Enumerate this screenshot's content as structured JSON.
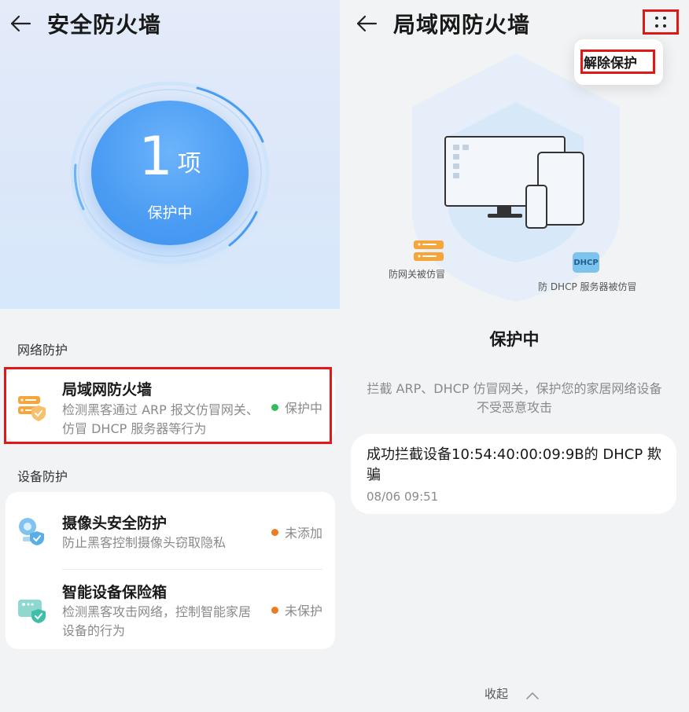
{
  "left": {
    "header": {
      "title": "安全防火墙",
      "back_icon": "back-arrow-icon"
    },
    "summary": {
      "count": "1",
      "unit": "项",
      "status": "保护中"
    },
    "network_section": {
      "label": "网络防护",
      "items": [
        {
          "title": "局域网防火墙",
          "desc": "检测黑客通过 ARP 报文仿冒网关、仿冒 DHCP 服务器等行为",
          "status": "保护中",
          "status_color": "#2fbe5a",
          "icon": "server-shield-icon"
        }
      ]
    },
    "device_section": {
      "label": "设备防护",
      "items": [
        {
          "title": "摄像头安全防护",
          "desc": "防止黑客控制摄像头窃取隐私",
          "status": "未添加",
          "status_color": "#f07a1e",
          "icon": "camera-shield-icon"
        },
        {
          "title": "智能设备保险箱",
          "desc": "检测黑客攻击网络，控制智能家居设备的行为",
          "status": "未保护",
          "status_color": "#f07a1e",
          "icon": "smart-device-shield-icon"
        }
      ]
    }
  },
  "right": {
    "header": {
      "title": "局域网防火墙",
      "back_icon": "back-arrow-icon",
      "more_icon": "more-dots-icon"
    },
    "popup": {
      "item": "解除保护"
    },
    "illustration": {
      "gateway_label": "防网关被仿冒",
      "dhcp_badge": "DHCP",
      "dhcp_label": "防 DHCP 服务器被仿冒"
    },
    "status": "保护中",
    "description": "拦截 ARP、DHCP 仿冒网关，保护您的家居网络设备不受恶意攻击",
    "log": {
      "text": "成功拦截设备10:54:40:00:09:9B的 DHCP 欺骗",
      "time": "08/06 09:51"
    },
    "collapse_label": "收起"
  },
  "colors": {
    "accent_blue": "#4a9cf3",
    "highlight_red": "#e01818",
    "status_green": "#2fbe5a",
    "status_orange": "#f07a1e"
  }
}
